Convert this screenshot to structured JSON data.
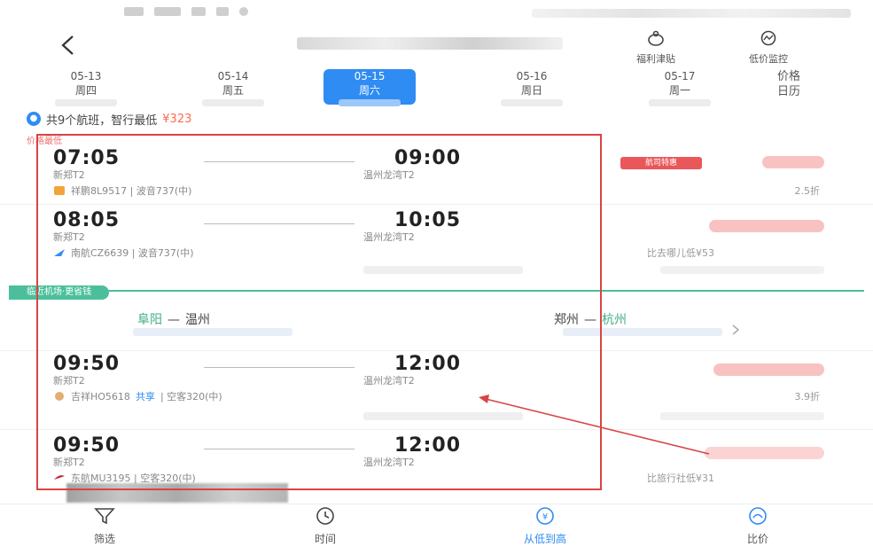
{
  "header": {
    "actions": [
      {
        "label": "福利津贴",
        "icon": "gift-bag-icon"
      },
      {
        "label": "低价监控",
        "icon": "price-monitor-icon"
      }
    ]
  },
  "dates": [
    {
      "date": "05-13",
      "weekday": "周四",
      "active": false
    },
    {
      "date": "05-14",
      "weekday": "周五",
      "active": false
    },
    {
      "date": "05-15",
      "weekday": "周六",
      "active": true
    },
    {
      "date": "05-16",
      "weekday": "周日",
      "active": false
    },
    {
      "date": "05-17",
      "weekday": "周一",
      "active": false
    }
  ],
  "calendar": {
    "line1": "价格",
    "line2": "日历"
  },
  "summary": {
    "text": "共9个航班，智行最低",
    "price": "¥323"
  },
  "cheapest_tag": "价格最低",
  "flights": [
    {
      "dep_time": "07:05",
      "arr_time": "09:00",
      "dep_airport": "新郑T2",
      "arr_airport": "温州龙湾T2",
      "info": "祥鹏8L9517 | 波音737(中)",
      "share": "",
      "discount": "2.5折",
      "tagline": "",
      "badge": "航司特惠"
    },
    {
      "dep_time": "08:05",
      "arr_time": "10:05",
      "dep_airport": "新郑T2",
      "arr_airport": "温州龙湾T2",
      "info": "南航CZ6639 | 波音737(中)",
      "share": "",
      "discount": "",
      "tagline": "比去哪儿低¥53",
      "badge": ""
    },
    {
      "dep_time": "09:50",
      "arr_time": "12:00",
      "dep_airport": "新郑T2",
      "arr_airport": "温州龙湾T2",
      "info": "吉祥HO5618",
      "share": "共享",
      "info2": "| 空客320(中)",
      "discount": "3.9折",
      "tagline": "",
      "badge": ""
    },
    {
      "dep_time": "09:50",
      "arr_time": "12:00",
      "dep_airport": "新郑T2",
      "arr_airport": "温州龙湾T2",
      "info": "东航MU3195 | 空客320(中)",
      "share": "",
      "discount": "",
      "tagline": "比旅行社低¥31",
      "badge": ""
    }
  ],
  "nearby": {
    "tag": "临近机场·更省钱",
    "routes": [
      {
        "from": "阜阳",
        "to": "温州"
      },
      {
        "from": "郑州",
        "to": "杭州"
      }
    ]
  },
  "bottom_nav": [
    {
      "label": "筛选",
      "icon": "filter-icon",
      "active": false
    },
    {
      "label": "时间",
      "icon": "clock-icon",
      "active": false
    },
    {
      "label": "从低到高",
      "icon": "price-sort-icon",
      "active": true
    },
    {
      "label": "比价",
      "icon": "compare-icon",
      "active": false
    }
  ],
  "colors": {
    "accent": "#2f8cf2",
    "price": "#ff6a4d",
    "nearby": "#4bbf9c",
    "highlight": "#d84545"
  }
}
